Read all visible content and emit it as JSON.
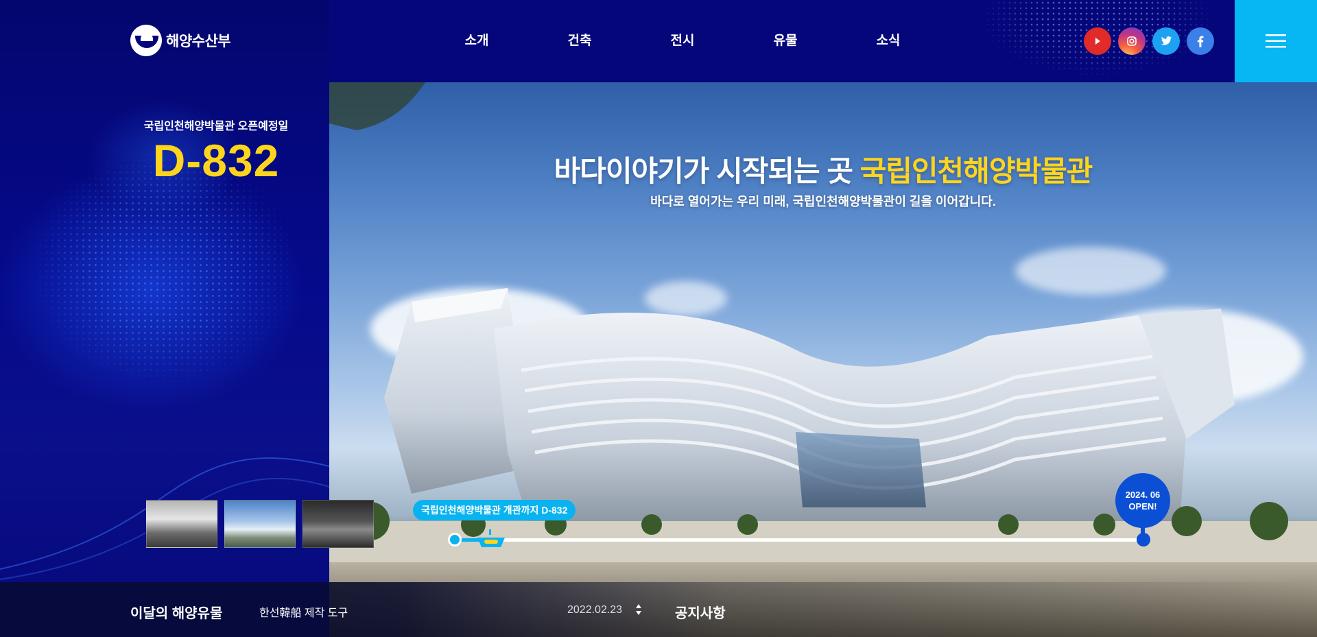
{
  "header": {
    "logo_text": "해양수산부",
    "nav": [
      "소개",
      "건축",
      "전시",
      "유물",
      "소식"
    ],
    "socials": [
      {
        "name": "youtube",
        "icon": "youtube-icon",
        "color": "#e12a2a"
      },
      {
        "name": "instagram",
        "icon": "instagram-icon",
        "color": "#c13584"
      },
      {
        "name": "twitter",
        "icon": "twitter-icon",
        "color": "#1da1f2"
      },
      {
        "name": "facebook",
        "icon": "facebook-icon",
        "color": "#3b7fe8"
      }
    ],
    "menu_icon": "hamburger-menu-icon",
    "menu_color": "#07b7f4"
  },
  "dday": {
    "label": "국립인천해양박물관 오픈예정일",
    "count": "D-832",
    "accent_color": "#ffd51c"
  },
  "hero": {
    "title_main": "바다이야기가 시작되는 곳 ",
    "title_accent": "국립인천해양박물관",
    "subtitle": "바다로 열어가는 우리 미래, 국립인천해양박물관이 길을 이어갑니다.",
    "timeline_badge": "국립인천해양박물관 개관까지 D-832",
    "timeline_progress": 0.06,
    "open_date": "2024. 06",
    "open_label": "OPEN!"
  },
  "thumbnails": [
    "thumbnail-1",
    "thumbnail-2",
    "thumbnail-3"
  ],
  "bottom": {
    "relic_title": "이달의 해양유물",
    "relic_name": "한선韓船 제작 도구",
    "notice_date": "2022.02.23",
    "notice_title": "공지사항"
  }
}
